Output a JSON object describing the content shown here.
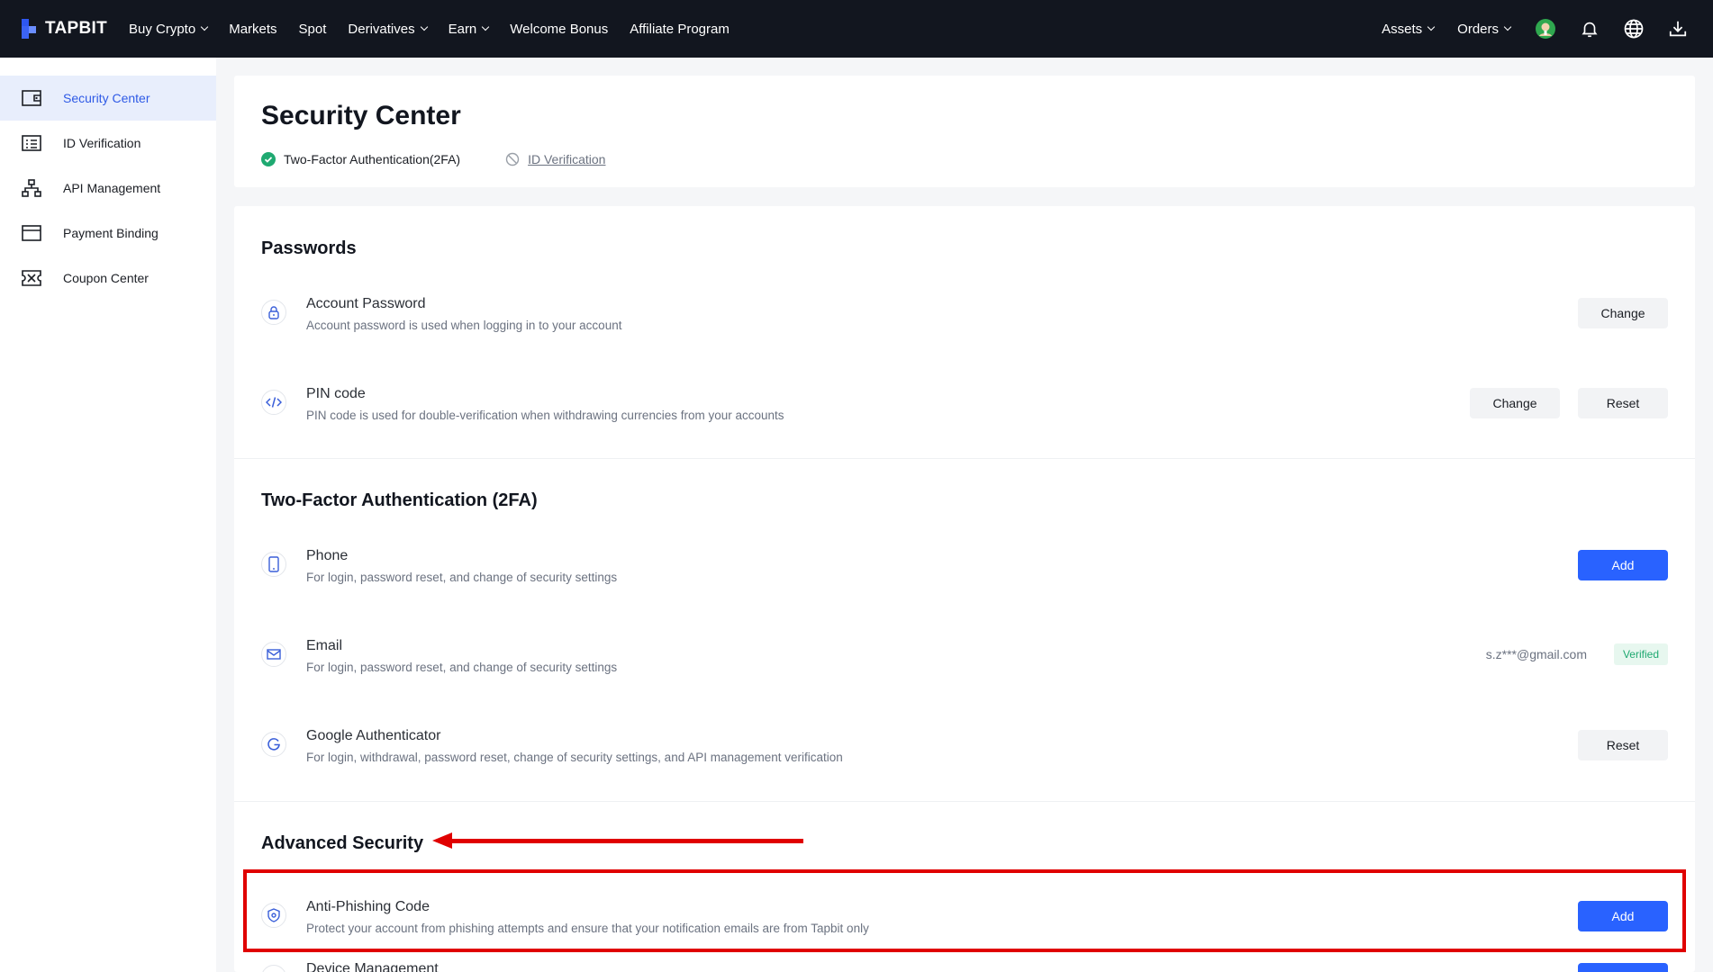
{
  "topnav": {
    "logo": "TAPBIT",
    "items": [
      {
        "label": "Buy Crypto",
        "dropdown": true
      },
      {
        "label": "Markets",
        "dropdown": false
      },
      {
        "label": "Spot",
        "dropdown": false
      },
      {
        "label": "Derivatives",
        "dropdown": true
      },
      {
        "label": "Earn",
        "dropdown": true
      },
      {
        "label": "Welcome Bonus",
        "dropdown": false
      },
      {
        "label": "Affiliate Program",
        "dropdown": false
      }
    ],
    "right": {
      "assets": "Assets",
      "orders": "Orders",
      "icons": [
        "avatar-icon",
        "bell-icon",
        "globe-icon",
        "download-icon"
      ]
    }
  },
  "sidebar": {
    "items": [
      {
        "label": "Security Center",
        "icon": "wallet-icon",
        "active": true
      },
      {
        "label": "ID Verification",
        "icon": "id-card-icon",
        "active": false
      },
      {
        "label": "API Management",
        "icon": "api-icon",
        "active": false
      },
      {
        "label": "Payment Binding",
        "icon": "card-icon",
        "active": false
      },
      {
        "label": "Coupon Center",
        "icon": "coupon-icon",
        "active": false
      }
    ]
  },
  "header": {
    "title": "Security Center",
    "status_2fa": "Two-Factor Authentication(2FA)",
    "status_id": "ID Verification"
  },
  "passwords": {
    "title": "Passwords",
    "account": {
      "title": "Account Password",
      "desc": "Account password is used when logging in to your account",
      "change": "Change"
    },
    "pin": {
      "title": "PIN code",
      "desc": "PIN code is used for double-verification when withdrawing currencies from your accounts",
      "change": "Change",
      "reset": "Reset"
    }
  },
  "twofa": {
    "title": "Two-Factor Authentication (2FA)",
    "phone": {
      "title": "Phone",
      "desc": "For login, password reset, and change of security settings",
      "add": "Add"
    },
    "email": {
      "title": "Email",
      "desc": "For login, password reset, and change of security settings",
      "value": "s.z***@gmail.com",
      "badge": "Verified"
    },
    "google": {
      "title": "Google Authenticator",
      "desc": "For login, withdrawal, password reset, change of security settings, and API management verification",
      "reset": "Reset"
    }
  },
  "advanced": {
    "title": "Advanced Security",
    "antiphishing": {
      "title": "Anti-Phishing Code",
      "desc": "Protect your account from phishing attempts and ensure that your notification emails are from Tapbit only",
      "add": "Add"
    },
    "device": {
      "title": "Device Management"
    }
  },
  "colors": {
    "accent": "#2962ff",
    "nav_bg": "#12161f",
    "annotation": "#e00000",
    "verified": "#1fa971"
  }
}
